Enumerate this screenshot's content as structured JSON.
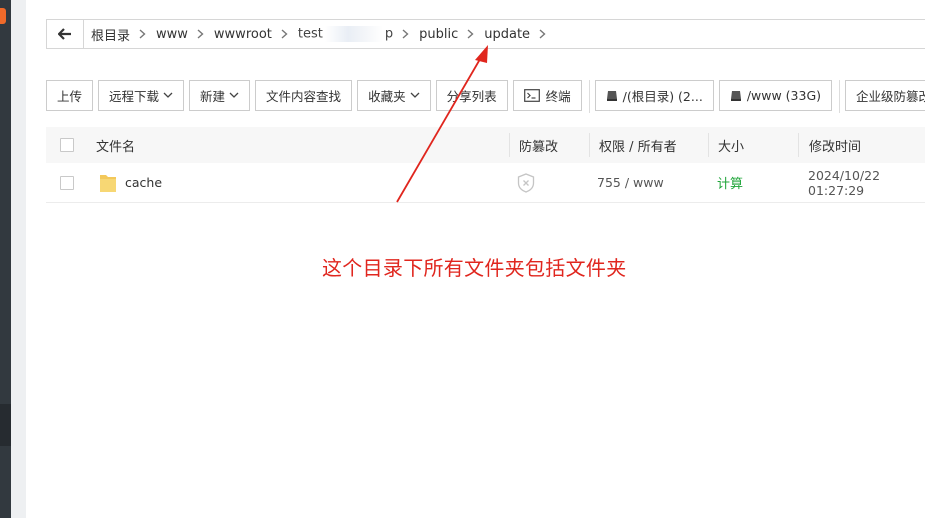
{
  "breadcrumb": {
    "items": [
      "根目录",
      "www",
      "wwwroot",
      "test",
      "p",
      "public",
      "update"
    ]
  },
  "toolbar": {
    "upload": "上传",
    "remote_download": "远程下载",
    "new": "新建",
    "search_content": "文件内容查找",
    "favorites": "收藏夹",
    "share_list": "分享列表",
    "terminal": "终端",
    "disk_root": "/(根目录) (2...",
    "disk_www": "/www (33G)",
    "tamper": "企业级防篡改"
  },
  "table": {
    "headers": {
      "name": "文件名",
      "tamper": "防篡改",
      "perm": "权限 / 所有者",
      "size": "大小",
      "mtime": "修改时间"
    },
    "rows": [
      {
        "name": "cache",
        "perm": "755 / www",
        "size": "计算",
        "mtime": "2024/10/22 01:27:29"
      }
    ]
  },
  "annotation": {
    "text": "这个目录下所有文件夹包括文件夹",
    "color": "#e0261e"
  },
  "colors": {
    "accent_green": "#20a53a",
    "sidebar": "#32393f",
    "logo_orange": "#f06a2a"
  },
  "icons": [
    "back-arrow-icon",
    "chevron-right-icon",
    "chevron-down-icon",
    "terminal-icon",
    "disk-icon",
    "folder-icon",
    "shield-icon"
  ]
}
